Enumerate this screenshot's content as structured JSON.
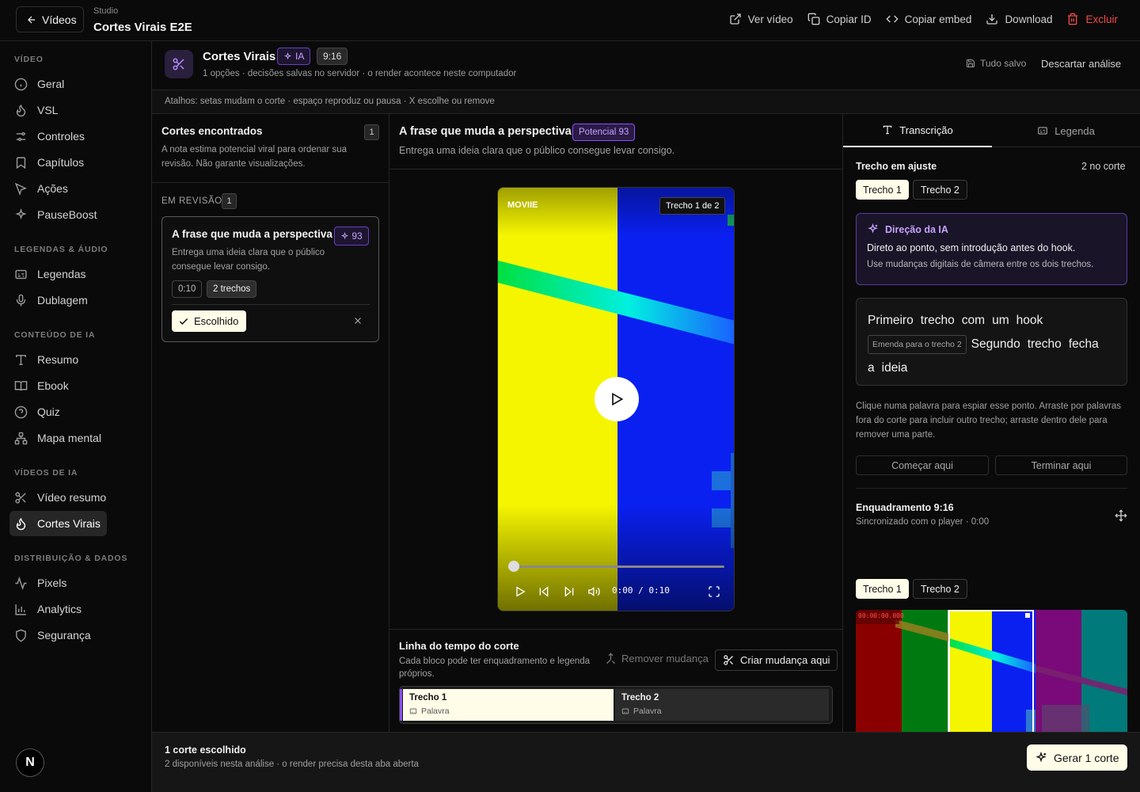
{
  "topbar": {
    "back_label": "Vídeos",
    "crumb_small": "Studio",
    "crumb_title": "Cortes Virais E2E",
    "actions": [
      {
        "label": "Ver vídeo",
        "icon": "external-link-icon"
      },
      {
        "label": "Copiar ID",
        "icon": "copy-icon"
      },
      {
        "label": "Copiar embed",
        "icon": "code-icon"
      },
      {
        "label": "Download",
        "icon": "download-icon"
      },
      {
        "label": "Excluir",
        "icon": "trash-icon"
      }
    ]
  },
  "sidebar": {
    "sections": [
      {
        "title": "VÍDEO",
        "items": [
          {
            "label": "Geral",
            "icon": "info-icon"
          },
          {
            "label": "VSL",
            "icon": "flame-icon"
          },
          {
            "label": "Controles",
            "icon": "sliders-icon"
          },
          {
            "label": "Capítulos",
            "icon": "bookmark-icon"
          },
          {
            "label": "Ações",
            "icon": "cursor-icon"
          },
          {
            "label": "PauseBoost",
            "icon": "sparkles-icon"
          }
        ]
      },
      {
        "title": "LEGENDAS & ÁUDIO",
        "items": [
          {
            "label": "Legendas",
            "icon": "captions-icon"
          },
          {
            "label": "Dublagem",
            "icon": "mic-icon"
          }
        ]
      },
      {
        "title": "CONTEÚDO DE IA",
        "items": [
          {
            "label": "Resumo",
            "icon": "text-icon"
          },
          {
            "label": "Ebook",
            "icon": "book-icon"
          },
          {
            "label": "Quiz",
            "icon": "help-circle-icon"
          },
          {
            "label": "Mapa mental",
            "icon": "network-icon"
          }
        ]
      },
      {
        "title": "VÍDEOS DE IA",
        "items": [
          {
            "label": "Vídeo resumo",
            "icon": "scissors-icon"
          },
          {
            "label": "Cortes Virais",
            "icon": "flame-icon",
            "active": true
          }
        ]
      },
      {
        "title": "DISTRIBUIÇÃO & DADOS",
        "items": [
          {
            "label": "Pixels",
            "icon": "activity-icon"
          },
          {
            "label": "Analytics",
            "icon": "bar-chart-icon"
          },
          {
            "label": "Segurança",
            "icon": "shield-icon"
          }
        ]
      }
    ],
    "logo_letter": "N"
  },
  "header": {
    "title": "Cortes Virais",
    "ia_badge": "IA",
    "ratio_badge": "9:16",
    "subtitle": "1 opções · decisões salvas no servidor · o render acontece neste computador",
    "saved_label": "Tudo salvo",
    "discard_label": "Descartar análise"
  },
  "shortcuts": "Atalhos: setas mudam o corte · espaço reproduz ou pausa · X escolhe ou remove",
  "cuts": {
    "title": "Cortes encontrados",
    "count": "1",
    "description": "A nota estima potencial viral para ordenar sua revisão. Não garante visualizações.",
    "review_label": "EM REVISÃO",
    "review_count": "1",
    "card": {
      "title": "A frase que muda a perspectiva",
      "score": "93",
      "description": "Entrega uma ideia clara que o público consegue levar consigo.",
      "duration": "0:10",
      "segments": "2 trechos",
      "chosen_label": "Escolhido"
    }
  },
  "preview": {
    "title": "A frase que muda a perspectiva",
    "potential": "Potencial 93",
    "description": "Entrega uma ideia clara que o público consegue levar consigo.",
    "overlay_logo": "MOVIIE",
    "overlay_trecho": "Trecho 1 de 2",
    "time": "0:00 / 0:10",
    "progress": 0
  },
  "timeline": {
    "title": "Linha do tempo do corte",
    "description": "Cada bloco pode ter enquadramento e legenda próprios.",
    "remove_label": "Remover mudança",
    "create_label": "Criar mudança aqui",
    "segments": [
      {
        "name": "Trecho 1",
        "sub": "Palavra"
      },
      {
        "name": "Trecho 2",
        "sub": "Palavra"
      }
    ]
  },
  "right": {
    "tabs": [
      {
        "label": "Transcrição",
        "icon": "text-icon"
      },
      {
        "label": "Legenda",
        "icon": "captions-icon"
      }
    ],
    "adjust_title": "Trecho em ajuste",
    "adjust_meta": "2 no corte",
    "segment_buttons": [
      "Trecho 1",
      "Trecho 2"
    ],
    "ai_direction": {
      "title": "Direção da IA",
      "line1": "Direto ao ponto, sem introdução antes do hook.",
      "line2": "Use mudanças digitais de câmera entre os dois trechos."
    },
    "transcript": {
      "words1": [
        "Primeiro",
        "trecho",
        "com",
        "um",
        "hook"
      ],
      "splice": "Emenda para o trecho 2",
      "words2": [
        "Segundo",
        "trecho",
        "fecha"
      ],
      "words3": [
        "a",
        "ideia"
      ]
    },
    "hint": "Clique numa palavra para espiar esse ponto. Arraste por palavras fora do corte para incluir outro trecho; arraste dentro dele para remover uma parte.",
    "start_here": "Começar aqui",
    "end_here": "Terminar aqui",
    "framing_title": "Enquadramento 9:16",
    "framing_sub": "Sincronizado com o player · 0:00",
    "framing_buttons": [
      "Trecho 1",
      "Trecho 2"
    ],
    "film_timecode": "00:00:00.000"
  },
  "footer": {
    "title": "1 corte escolhido",
    "subtitle": "2 disponíveis nesta análise · o render precisa desta aba aberta",
    "generate_label": "Gerar 1 corte"
  },
  "colors": {
    "accent_purple": "#b48cff",
    "danger": "#f04b4b",
    "chosen_bg": "#fffde8"
  }
}
